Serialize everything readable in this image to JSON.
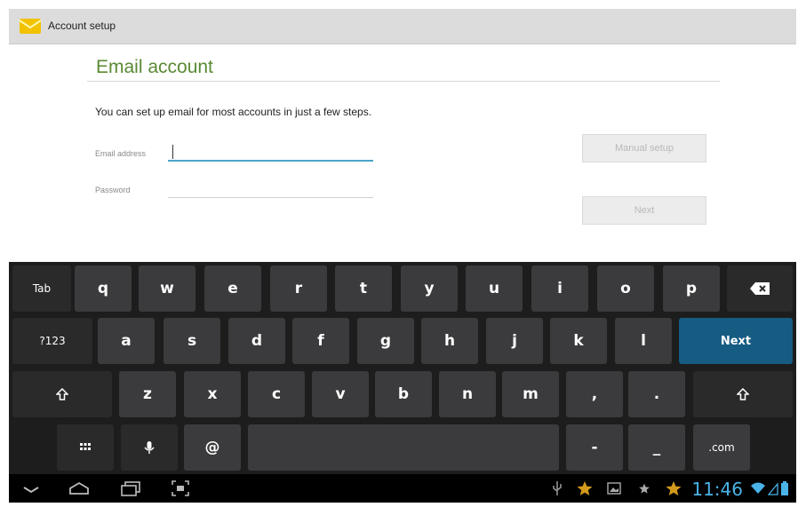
{
  "app": {
    "title": "Account setup",
    "icon": "email-app-icon"
  },
  "page": {
    "title": "Email account",
    "intro": "You can set up email for most accounts in just a few steps.",
    "email_label": "Email address",
    "email_value": "",
    "password_label": "Password",
    "password_value": "",
    "manual_setup_label": "Manual setup",
    "next_label": "Next"
  },
  "keyboard": {
    "row1": [
      "Tab",
      "q",
      "w",
      "e",
      "r",
      "t",
      "y",
      "u",
      "i",
      "o",
      "p"
    ],
    "row2": [
      "?123",
      "a",
      "s",
      "d",
      "f",
      "g",
      "h",
      "j",
      "k",
      "l",
      "Next"
    ],
    "row3": [
      "z",
      "x",
      "c",
      "v",
      "b",
      "n",
      "m",
      ",",
      "."
    ],
    "row4": [
      "@",
      "-",
      "_",
      ".com"
    ]
  },
  "status": {
    "time": "11:46"
  },
  "colors": {
    "accent": "#4aa6c9",
    "title_green": "#5a8a34",
    "next_key": "#155b82",
    "clock": "#4ab3e8"
  }
}
